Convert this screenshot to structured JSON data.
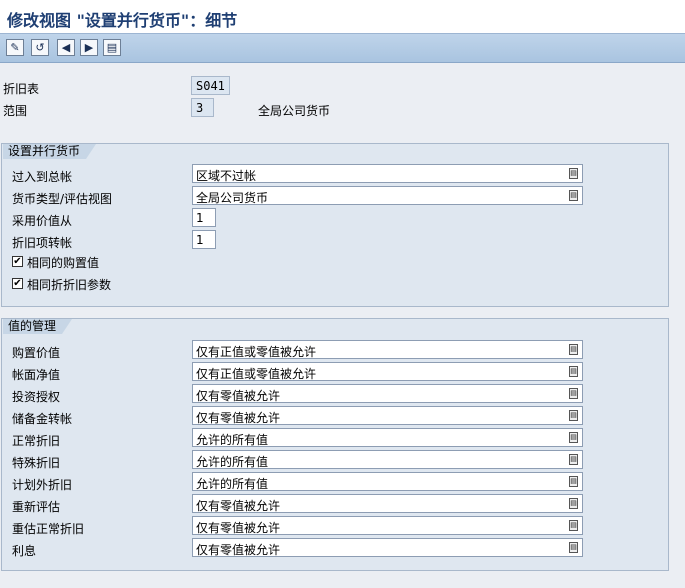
{
  "window": {
    "title": "修改视图 \"设置并行货币\"：细节"
  },
  "toolbar": {
    "buttons": [
      {
        "name": "edit-toggle-icon",
        "glyph": "✎"
      },
      {
        "name": "undo-icon",
        "glyph": "↺"
      },
      {
        "name": "previous-entry-icon",
        "glyph": "◀"
      },
      {
        "name": "next-entry-icon",
        "glyph": "▶"
      },
      {
        "name": "select-icon",
        "glyph": "▤"
      }
    ]
  },
  "header": {
    "depreciation_table_label": "折旧表",
    "depreciation_table_value": "S041",
    "area_label": "范围",
    "area_value": "3",
    "area_description": "全局公司货币"
  },
  "parallel_currency": {
    "group_title": "设置并行货币",
    "posting_label": "过入到总帐",
    "posting_value": "区域不过帐",
    "currency_type_label": "货币类型/评估视图",
    "currency_type_value": "全局公司货币",
    "take_values_label": "采用价值从",
    "take_values_value": "1",
    "depr_transfer_label": "折旧项转帐",
    "depr_transfer_value": "1",
    "same_acq_label": "相同的购置值",
    "same_acq_checked": "✔",
    "same_depr_label": "相同折折旧参数",
    "same_depr_checked": "✔"
  },
  "value_mgmt": {
    "group_title": "值的管理",
    "rows": [
      {
        "label": "购置价值",
        "value": "仅有正值或零值被允许"
      },
      {
        "label": "帐面净值",
        "value": "仅有正值或零值被允许"
      },
      {
        "label": "投资授权",
        "value": "仅有零值被允许"
      },
      {
        "label": "储备金转帐",
        "value": "仅有零值被允许"
      },
      {
        "label": "正常折旧",
        "value": "允许的所有值"
      },
      {
        "label": "特殊折旧",
        "value": "允许的所有值"
      },
      {
        "label": "计划外折旧",
        "value": "允许的所有值"
      },
      {
        "label": "重新评估",
        "value": "仅有零值被允许"
      },
      {
        "label": "重估正常折旧",
        "value": "仅有零值被允许"
      },
      {
        "label": "利息",
        "value": "仅有零值被允许"
      }
    ]
  },
  "dropdown_glyph": "▤"
}
